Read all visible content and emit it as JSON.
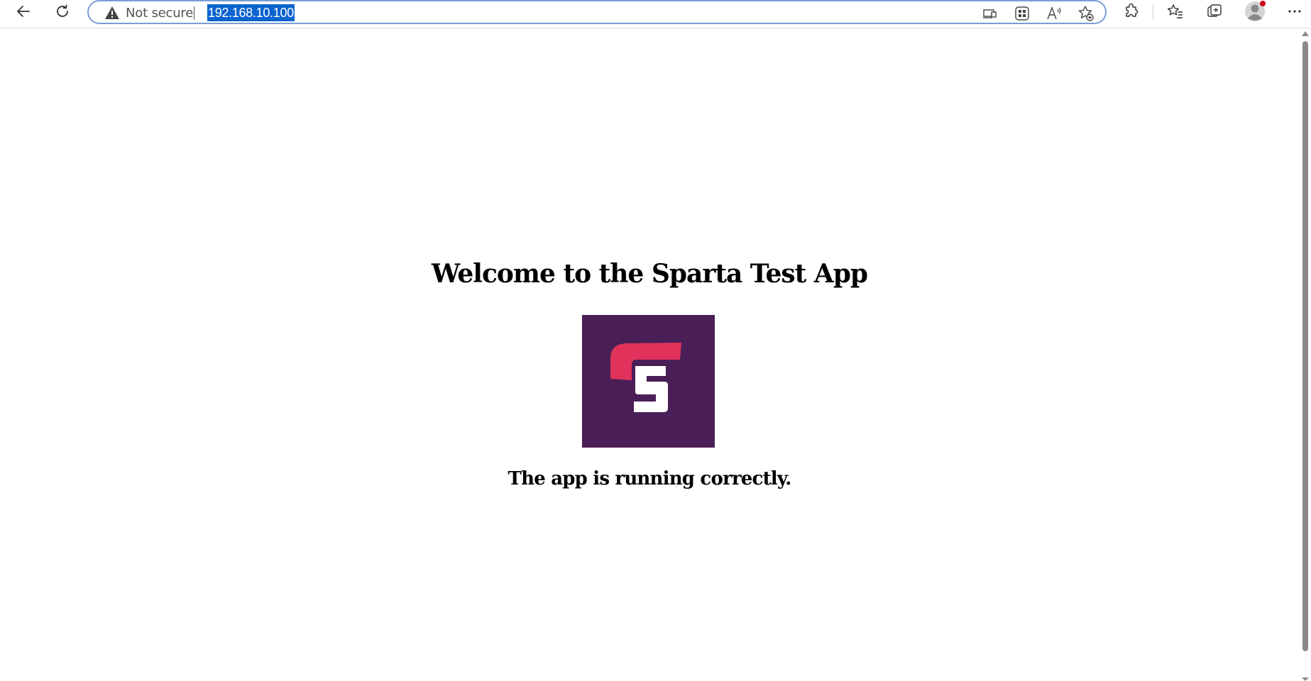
{
  "browser": {
    "security_label": "Not secure",
    "url": "192.168.10.100"
  },
  "page": {
    "title": "Welcome to the Sparta Test App",
    "status": "The app is running correctly."
  },
  "icons": {
    "back": "arrow-left",
    "refresh": "refresh",
    "warning": "warning-triangle",
    "app_available": "app-install",
    "immersive_reader": "grid-reader",
    "read_aloud": "read-aloud",
    "add_favorite": "star-plus",
    "extensions": "puzzle",
    "favorites": "star-list",
    "collections": "collections",
    "profile": "avatar",
    "more": "ellipsis"
  },
  "colors": {
    "logo_bg": "#4a1f57",
    "logo_accent": "#e0325a",
    "selection": "#0b63ce",
    "notification_dot": "#d0021b"
  }
}
